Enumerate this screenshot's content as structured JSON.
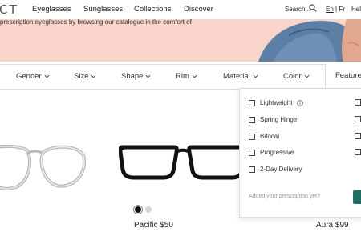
{
  "brand": {
    "logo_text": "CT"
  },
  "nav": {
    "items": [
      "Eyeglasses",
      "Sunglasses",
      "Collections",
      "Discover"
    ],
    "search_label": "Search...",
    "lang_en": "En",
    "lang_sep": " | ",
    "lang_fr": "Fr",
    "help": "Hel"
  },
  "hero": {
    "text": "prescription eyeglasses by browsing our catalogue in the comfort of"
  },
  "filters": {
    "items": [
      "Gender",
      "Size",
      "Shape",
      "Rim",
      "Material",
      "Color"
    ],
    "feature": "Feature"
  },
  "dropdown": {
    "options": [
      "Lightweight",
      "Spring Hinge",
      "Bifocal",
      "Progressive",
      "2-Day Delivery"
    ],
    "prescription_prompt": "Added your prescription yet?"
  },
  "products": [
    {
      "name_price": "Pacific $50",
      "colors": [
        "#111111",
        "#d5d5d5"
      ]
    },
    {
      "name_price": "Aura $99"
    }
  ],
  "colors": {
    "accent": "#1d6e64",
    "hero_bg": "#f9d4cb"
  }
}
